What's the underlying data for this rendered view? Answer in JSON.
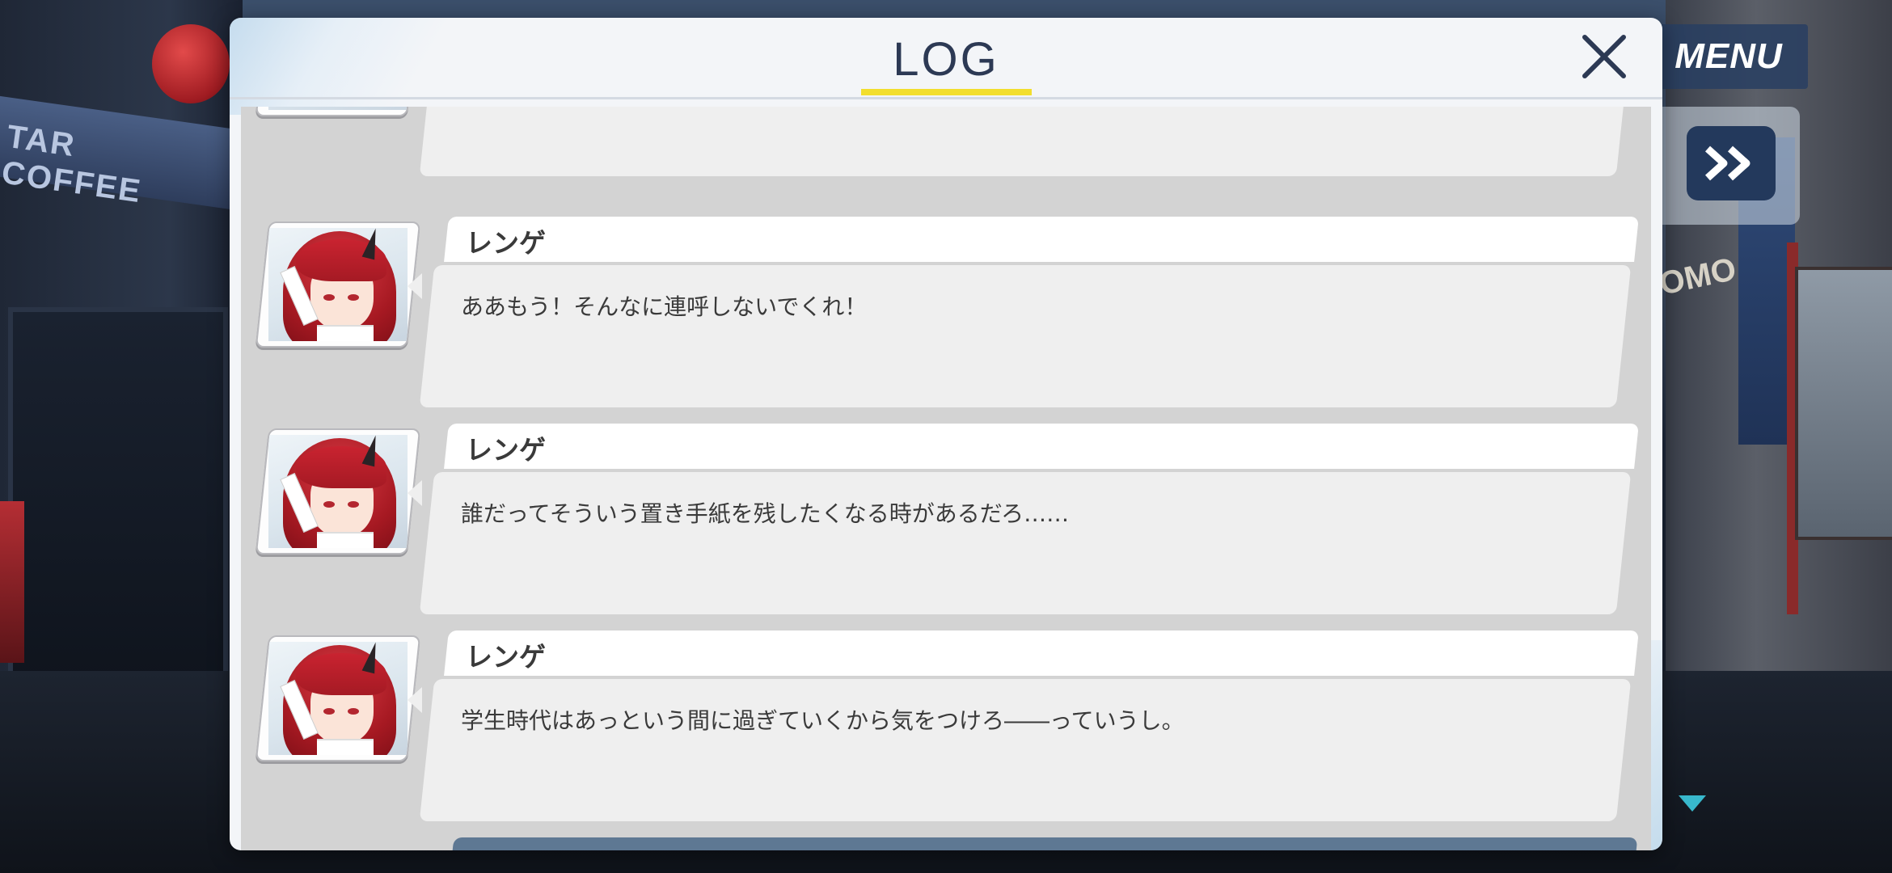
{
  "dialog": {
    "title": "LOG",
    "close_label": "×",
    "accent_color": "#f2de2e"
  },
  "hud": {
    "menu_label": "MENU",
    "fast_forward_icon": "fast-forward-icon",
    "scroll_indicator_icon": "triangle-down-icon"
  },
  "background": {
    "left_sign": "TAR COFFEE",
    "right_sign": "OMO"
  },
  "entries": [
    {
      "speaker": "",
      "text": ""
    },
    {
      "speaker": "レンゲ",
      "text": "ああもう！そんなに連呼しないでくれ！"
    },
    {
      "speaker": "レンゲ",
      "text": "誰だってそういう置き手紙を残したくなる時があるだろ……"
    },
    {
      "speaker": "レンゲ",
      "text": "学生時代はあっという間に過ぎていくから気をつけろ――っていうし。"
    }
  ]
}
